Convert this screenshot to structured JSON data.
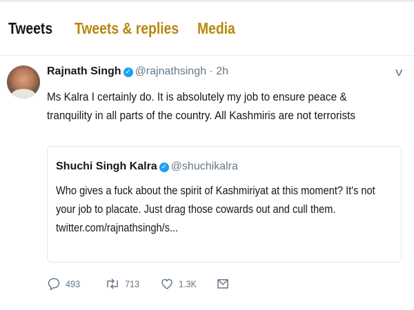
{
  "tabs": [
    {
      "label": "Tweets"
    },
    {
      "label": "Tweets & replies"
    },
    {
      "label": "Media"
    }
  ],
  "tweet": {
    "author_name": "Rajnath Singh",
    "author_handle": "@rajnathsingh",
    "separator": "·",
    "time": "2h",
    "text": "Ms Kalra I certainly do. It is absolutely my job to ensure peace & tranquility in all parts of the country. All Kashmiris are not terrorists",
    "quoted": {
      "author_name": "Shuchi Singh Kalra",
      "author_handle": "@shuchikalra",
      "text": "Who gives a fuck about the spirit of Kashmiriyat at this moment? It's not your job to placate. Just drag those cowards out and cull them. twitter.com/rajnathsingh/s..."
    },
    "actions": {
      "replies": "493",
      "retweets": "713",
      "likes": "1.3K"
    }
  },
  "colors": {
    "active_tab": "#14171a",
    "inactive_tab": "#b8860b",
    "verified": "#1da1f2",
    "muted": "#657786",
    "border": "#e1e8ed"
  },
  "icons": [
    "verified-badge-icon",
    "chevron-down-icon",
    "reply-icon",
    "retweet-icon",
    "like-icon",
    "message-icon"
  ]
}
